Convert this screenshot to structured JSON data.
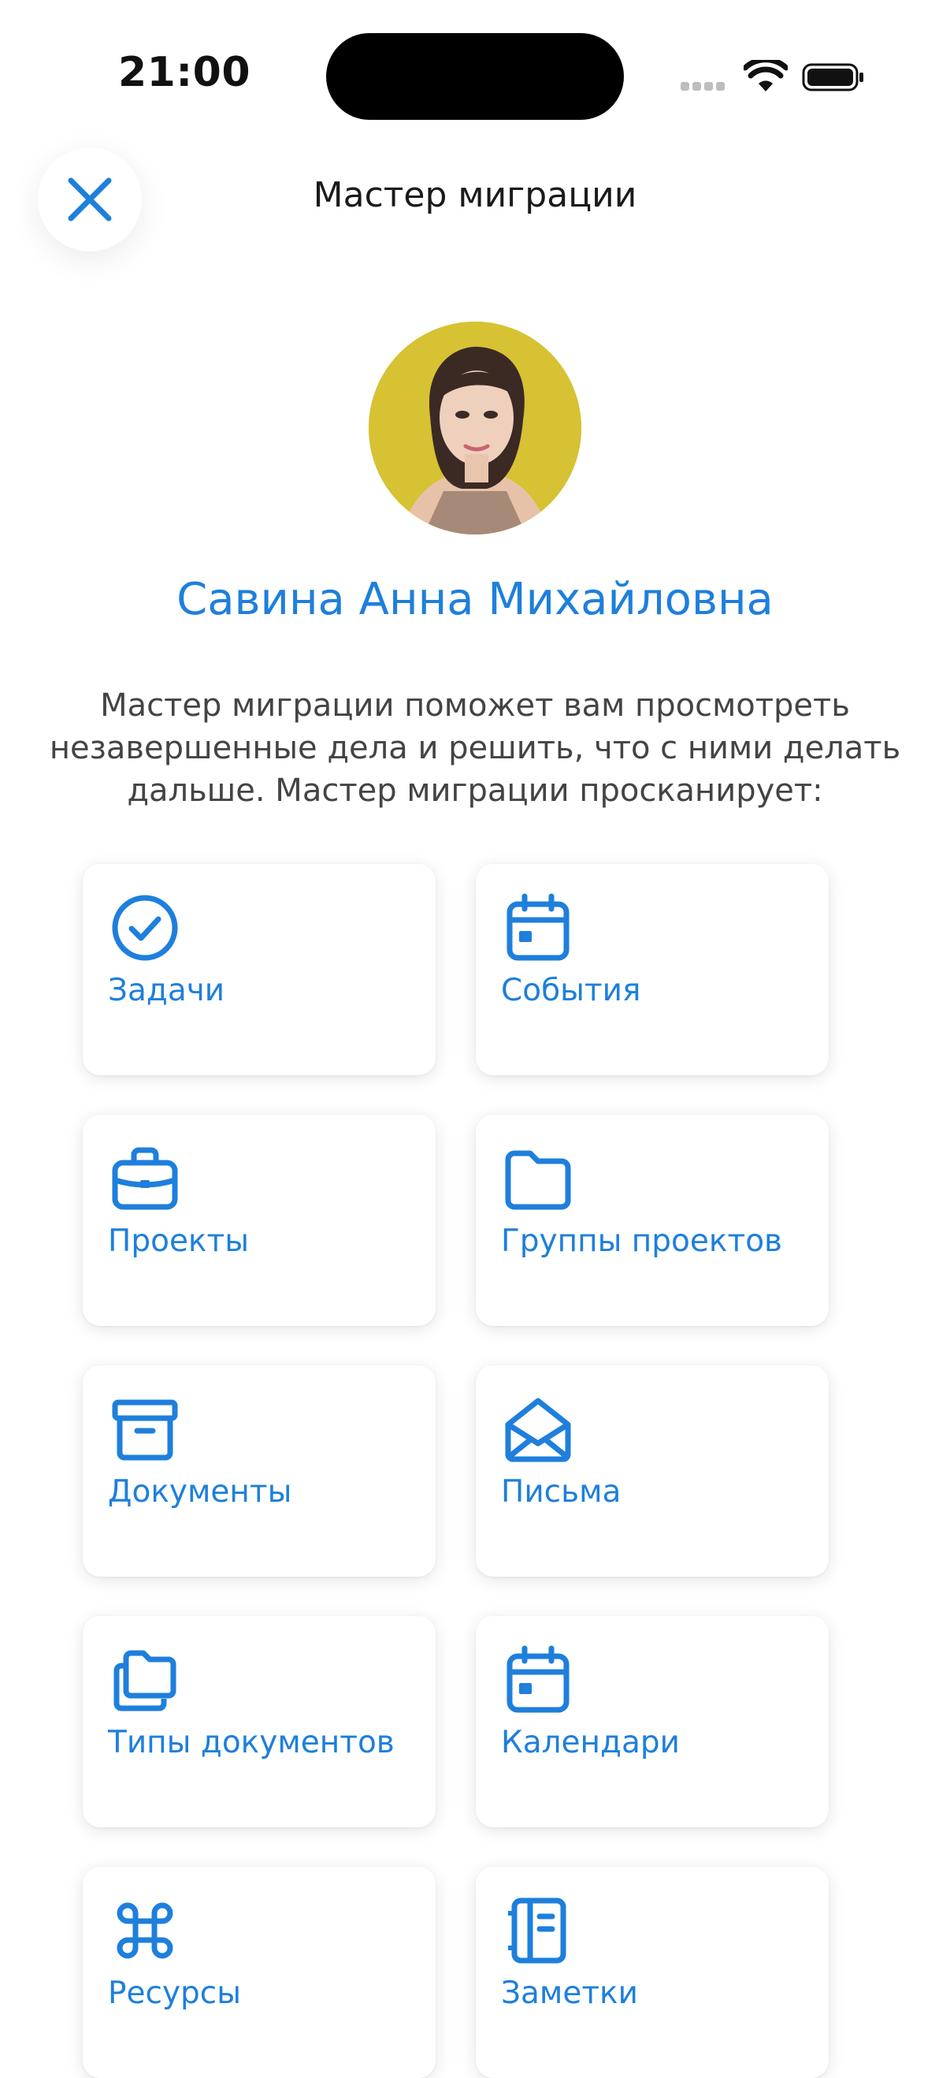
{
  "status_bar": {
    "time": "21:00"
  },
  "header": {
    "title": "Мастер миграции",
    "close_icon": "close-icon"
  },
  "profile": {
    "name": "Савина Анна Михайловна"
  },
  "intro_text": "Мастер миграции поможет вам просмотреть незавершенные дела и решить, что с ними делать дальше. Мастер миграции просканирует:",
  "colors": {
    "accent": "#1e7fdc",
    "text": "#444444",
    "background": "#ffffff"
  },
  "categories": [
    {
      "label": "Задачи",
      "icon": "check-circle-icon"
    },
    {
      "label": "События",
      "icon": "calendar-icon"
    },
    {
      "label": "Проекты",
      "icon": "briefcase-icon"
    },
    {
      "label": "Группы проектов",
      "icon": "folder-icon"
    },
    {
      "label": "Документы",
      "icon": "archive-box-icon"
    },
    {
      "label": "Письма",
      "icon": "open-envelope-icon"
    },
    {
      "label": "Типы документов",
      "icon": "folders-stack-icon"
    },
    {
      "label": "Календари",
      "icon": "calendar-icon"
    },
    {
      "label": "Ресурсы",
      "icon": "command-icon"
    },
    {
      "label": "Заметки",
      "icon": "notebook-icon"
    }
  ]
}
